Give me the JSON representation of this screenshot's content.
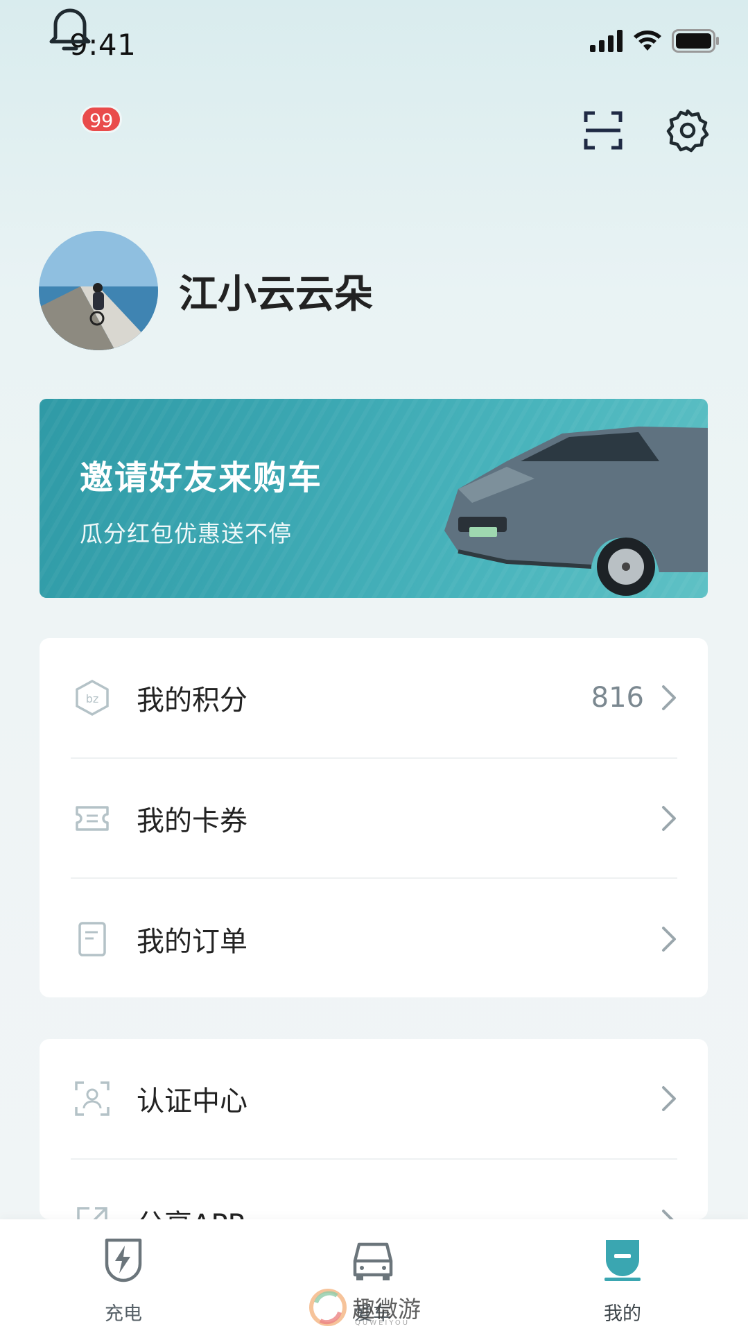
{
  "status_bar": {
    "time": "9:41"
  },
  "header": {
    "notification_badge": "99"
  },
  "profile": {
    "username": "江小云云朵"
  },
  "banner": {
    "title": "邀请好友来购车",
    "subtitle": "瓜分红包优惠送不停"
  },
  "menu_group_1": {
    "items": [
      {
        "label": "我的积分",
        "value": "816",
        "icon": "points-icon"
      },
      {
        "label": "我的卡券",
        "value": "",
        "icon": "coupon-icon"
      },
      {
        "label": "我的订单",
        "value": "",
        "icon": "order-icon"
      }
    ]
  },
  "menu_group_2": {
    "items": [
      {
        "label": "认证中心",
        "icon": "verification-icon"
      },
      {
        "label": "分享APP",
        "icon": "share-icon"
      }
    ]
  },
  "tabbar": {
    "tabs": [
      {
        "label": "充电",
        "icon": "charging-icon"
      },
      {
        "label": "爱车",
        "icon": "car-icon"
      },
      {
        "label": "我的",
        "icon": "profile-icon"
      }
    ],
    "active_index": 2
  },
  "watermark": {
    "text": "趣微游",
    "sub": "QUWEIYOU"
  },
  "colors": {
    "accent": "#3aa6b1",
    "badge": "#e94b4b",
    "icon_dark": "#1f2a44"
  }
}
